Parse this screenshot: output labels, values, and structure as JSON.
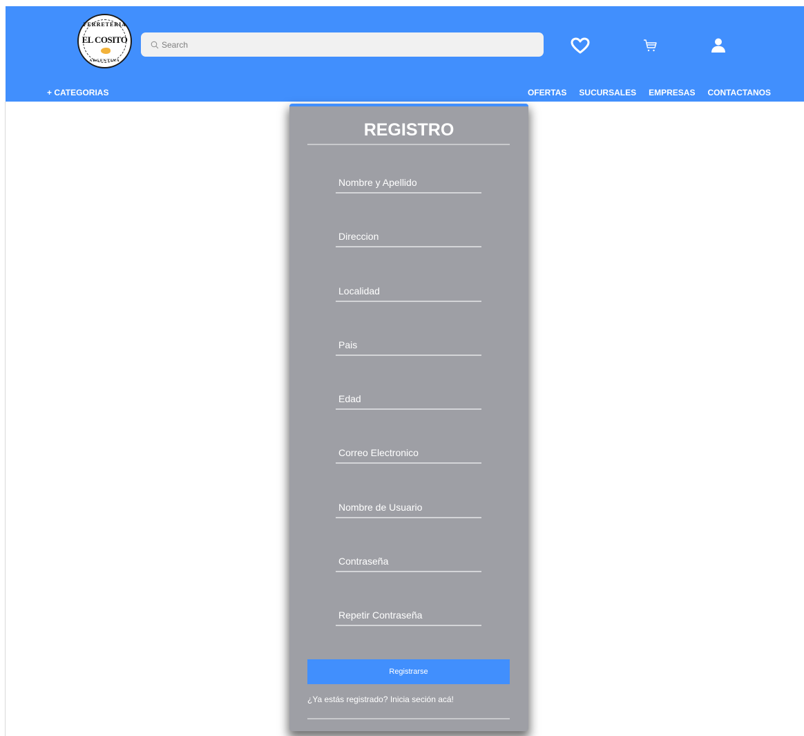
{
  "header": {
    "logo": {
      "top_text": "FERRETERIA",
      "brand": "EL COSITO",
      "bottom_text": "ARGENTINA"
    },
    "search": {
      "placeholder": "Search",
      "icon": "search-icon"
    },
    "icons": [
      "heart-icon",
      "cart-icon",
      "user-icon"
    ],
    "colors": {
      "bar": "#418ffd",
      "search_bg": "#f1f1f1"
    }
  },
  "nav": {
    "categories": "+ CATEGORIAS",
    "links": [
      "OFERTAS",
      "SUCURSALES",
      "EMPRESAS",
      "CONTACTANOS"
    ]
  },
  "form": {
    "title": "REGISTRO",
    "fields": [
      "Nombre y Apellido",
      "Direccion",
      "Localidad",
      "Pais",
      "Edad",
      "Correo Electronico",
      "Nombre de Usuario",
      "Contraseña",
      "Repetir Contraseña"
    ],
    "submit_label": "Registrarse",
    "login_prompt": "¿Ya estás registrado? Inicia seción acá!",
    "colors": {
      "card": "#9e9fa5",
      "button": "#418ffd"
    }
  }
}
